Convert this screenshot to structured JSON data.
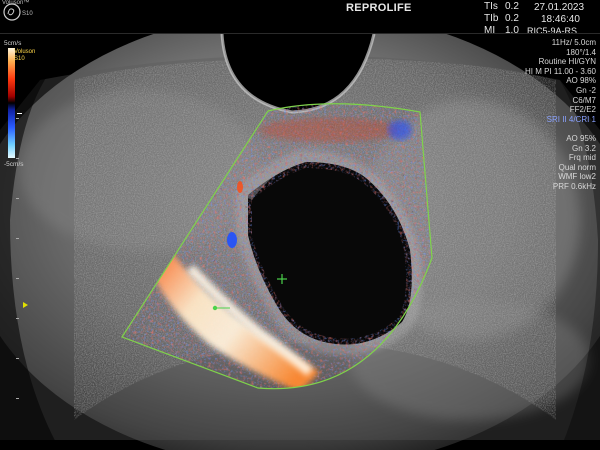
{
  "header": {
    "brand_name": "Voluson",
    "brand_model": "S10",
    "institution": "REPROLIFE",
    "tis_label": "TIs",
    "tis_value": "0.2",
    "tib_label": "TIb",
    "tib_value": "0.2",
    "mi_label": "MI",
    "mi_value": "1.0",
    "date": "27.01.2023",
    "time": "18:46:40",
    "probe": "RIC5-9A-RS"
  },
  "parameters": [
    "11Hz/ 5.0cm",
    "180°/1.4",
    "Routine HI/GYN",
    "HI M PI 11.00 - 3.60",
    "AO 98%",
    "Gn -2",
    "C6/M7",
    "FF2/E2",
    "SRI II 4/CRI 1",
    "",
    "AO 95%",
    "Gn 3.2",
    "Frq mid",
    "Qual norm",
    "WMF low2",
    "PRF 0.6kHz"
  ],
  "color_scale": {
    "top_label": "5cm/s",
    "bottom_label": "-5cm/s",
    "colors": [
      "#fff7e0",
      "#ff3a10",
      "#a00000",
      "#000000",
      "#1020a0",
      "#2a5cff",
      "#e8fbff"
    ]
  },
  "icons": {
    "logo": "ge-logo-icon",
    "focus": "focus-marker-icon",
    "caliper": "caliper-cross-icon"
  },
  "colors": {
    "color_box_outline": "#7fd34a",
    "param_highlight": "#8aa2ff",
    "mode_label": "#ffd84a"
  }
}
